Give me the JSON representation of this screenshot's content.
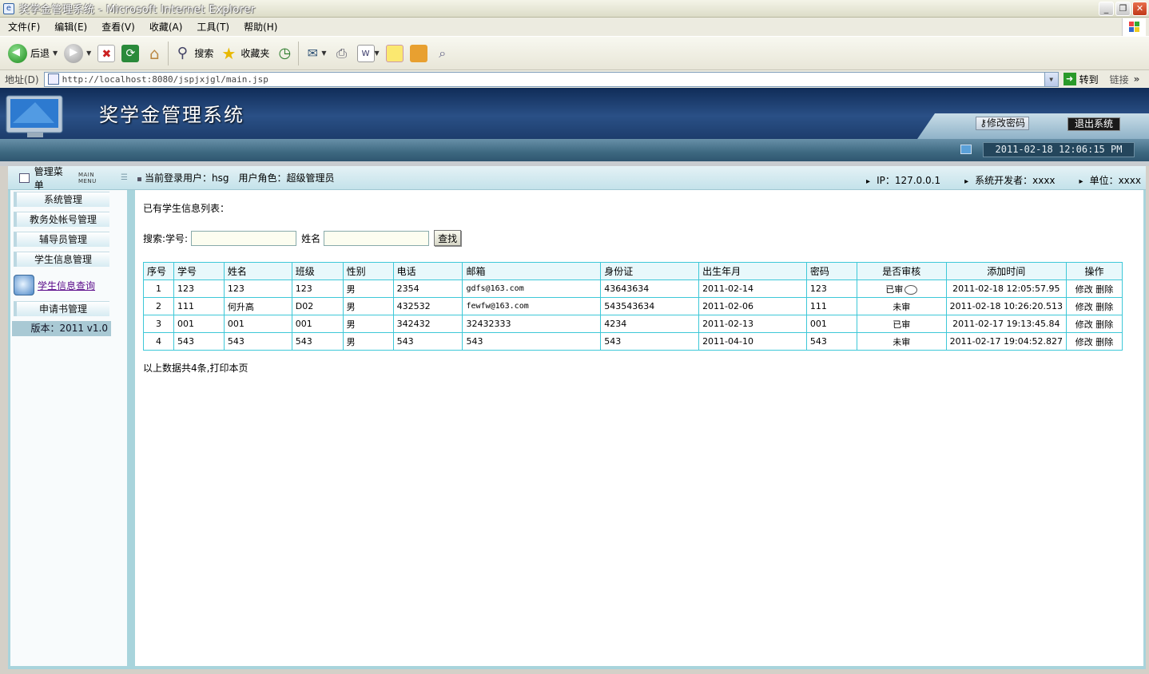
{
  "window": {
    "title": "奖学金管理系统 - Microsoft Internet Explorer"
  },
  "menu": [
    "文件(F)",
    "编辑(E)",
    "查看(V)",
    "收藏(A)",
    "工具(T)",
    "帮助(H)"
  ],
  "toolbar": {
    "back_label": "后退",
    "search_label": "搜索",
    "favorites_label": "收藏夹"
  },
  "address": {
    "label": "地址(D)",
    "url": "http://localhost:8080/jspjxjgl/main.jsp",
    "go_label": "转到",
    "links_label": "链接"
  },
  "app": {
    "title": "奖学金管理系统",
    "change_password": "修改密码",
    "logout": "退出系统",
    "datetime": "2011-02-18 12:06:15 PM"
  },
  "topbar": {
    "menu_title": "管理菜单",
    "menu_sub": "MAIN MENU",
    "current_user": "当前登录用户：hsg",
    "role": "用户角色：超级管理员",
    "ip": "IP：127.0.0.1",
    "developer": "系统开发者：xxxx",
    "unit": "单位：xxxx"
  },
  "sidebar": {
    "items": [
      "系统管理",
      "教务处帐号管理",
      "辅导员管理",
      "学生信息管理"
    ],
    "query_link": "学生信息查询",
    "item_apply": "申请书管理",
    "version": "版本：2011 v1.0"
  },
  "content": {
    "list_title": "已有学生信息列表：",
    "search_label": "搜索:学号:",
    "name_label": "姓名",
    "search_button": "查找",
    "columns": [
      "序号",
      "学号",
      "姓名",
      "班级",
      "性别",
      "电话",
      "邮箱",
      "身份证",
      "出生年月",
      "密码",
      "是否审核",
      "添加时间",
      "操作"
    ],
    "rows": [
      [
        "1",
        "123",
        "123",
        "123",
        "男",
        "2354",
        "gdfs@163.com",
        "43643634",
        "2011-02-14",
        "123",
        "已审",
        "2011-02-18 12:05:57.95"
      ],
      [
        "2",
        "111",
        "何升高",
        "D02",
        "男",
        "432532",
        "fewfw@163.com",
        "543543634",
        "2011-02-06",
        "111",
        "未审",
        "2011-02-18 10:26:20.513"
      ],
      [
        "3",
        "001",
        "001",
        "001",
        "男",
        "342432",
        "32432333",
        "4234",
        "2011-02-13",
        "001",
        "已审",
        "2011-02-17 19:13:45.84"
      ],
      [
        "4",
        "543",
        "543",
        "543",
        "男",
        "543",
        "543",
        "543",
        "2011-04-10",
        "543",
        "未审",
        "2011-02-17 19:04:52.827"
      ]
    ],
    "edit_label": "修改",
    "delete_label": "删除",
    "footer": "以上数据共4条,打印本页"
  }
}
